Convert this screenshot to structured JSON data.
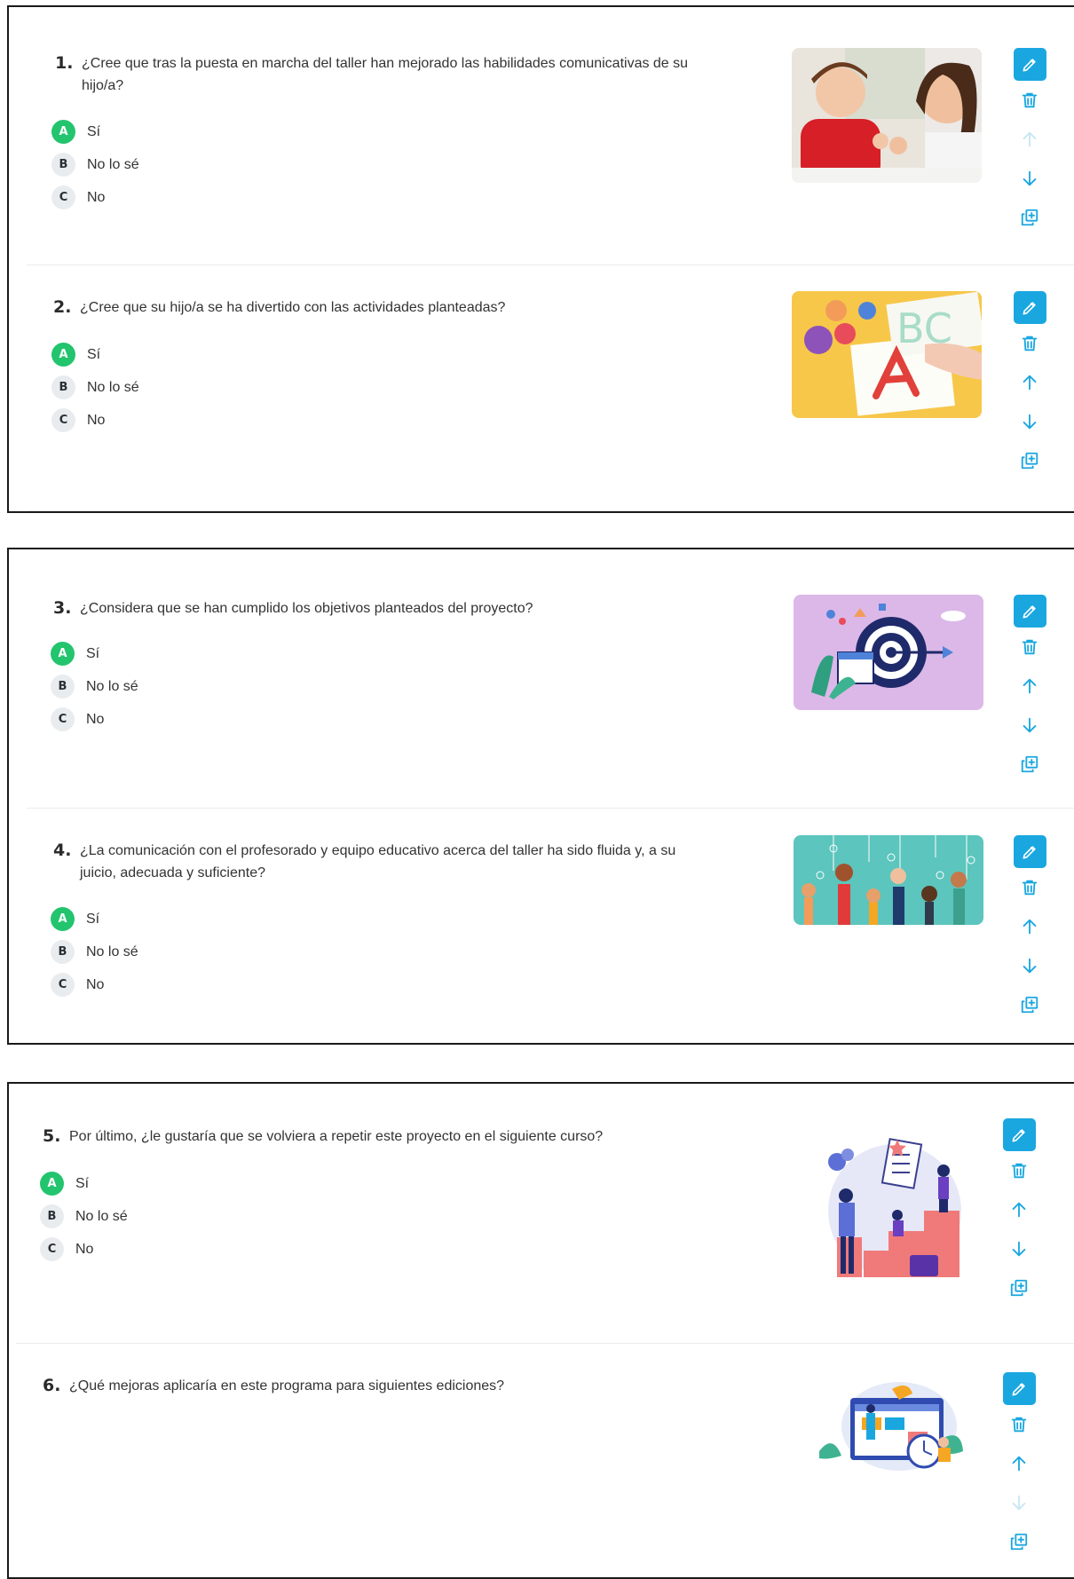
{
  "colors": {
    "accent": "#1aa7e0",
    "selected": "#23c46e",
    "badge_bg": "#e9ecef",
    "disabled": "#c8e6f3"
  },
  "questions": [
    {
      "number": "1.",
      "text": "¿Cree que tras la puesta en marcha del taller han mejorado las habilidades comunicativas de su hijo/a?",
      "options": [
        {
          "letter": "A",
          "label": "Sí",
          "selected": true
        },
        {
          "letter": "B",
          "label": "No lo sé"
        },
        {
          "letter": "C",
          "label": "No"
        }
      ],
      "image_icon": "child-therapy-photo",
      "move_up_enabled": false,
      "move_down_enabled": true
    },
    {
      "number": "2.",
      "text": "¿Cree que su hijo/a se ha divertido con las actividades planteadas?",
      "options": [
        {
          "letter": "A",
          "label": "Sí",
          "selected": true
        },
        {
          "letter": "B",
          "label": "No lo sé"
        },
        {
          "letter": "C",
          "label": "No"
        }
      ],
      "image_icon": "abc-letters-photo",
      "move_up_enabled": true,
      "move_down_enabled": true
    },
    {
      "number": "3.",
      "text": "¿Considera que se han cumplido los objetivos planteados del proyecto?",
      "options": [
        {
          "letter": "A",
          "label": "Sí",
          "selected": true
        },
        {
          "letter": "B",
          "label": "No lo sé"
        },
        {
          "letter": "C",
          "label": "No"
        }
      ],
      "image_icon": "target-goals-illustration",
      "move_up_enabled": true,
      "move_down_enabled": true
    },
    {
      "number": "4.",
      "text": "¿La comunicación con el profesorado y equipo educativo acerca del taller ha sido fluida y, a su juicio, adecuada y suficiente?",
      "options": [
        {
          "letter": "A",
          "label": "Sí",
          "selected": true
        },
        {
          "letter": "B",
          "label": "No lo sé"
        },
        {
          "letter": "C",
          "label": "No"
        }
      ],
      "image_icon": "raised-hands-illustration",
      "move_up_enabled": true,
      "move_down_enabled": true
    },
    {
      "number": "5.",
      "text": "Por último, ¿le gustaría que se volviera a repetir este proyecto en el siguiente curso?",
      "options": [
        {
          "letter": "A",
          "label": "Sí",
          "selected": true
        },
        {
          "letter": "B",
          "label": "No lo sé"
        },
        {
          "letter": "C",
          "label": "No"
        }
      ],
      "image_icon": "growth-steps-illustration",
      "move_up_enabled": true,
      "move_down_enabled": true
    },
    {
      "number": "6.",
      "text": "¿Qué mejoras aplicaría en este programa para siguientes ediciones?",
      "options": [],
      "image_icon": "planning-screen-illustration",
      "move_up_enabled": true,
      "move_down_enabled": false
    }
  ],
  "actions": {
    "edit_icon": "pencil-icon",
    "delete_icon": "trash-icon",
    "up_icon": "arrow-up-icon",
    "down_icon": "arrow-down-icon",
    "duplicate_icon": "duplicate-icon"
  }
}
